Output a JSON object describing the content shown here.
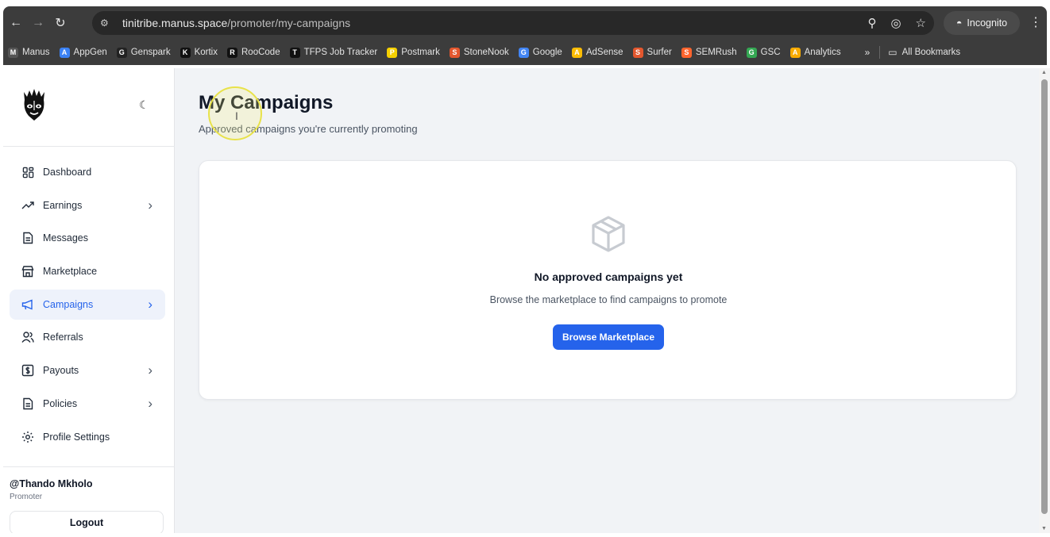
{
  "browser": {
    "url_host": "tinitribe.manus.space",
    "url_path": "/promoter/my-campaigns",
    "incognito_label": "Incognito",
    "bookmarks": [
      {
        "label": "Manus",
        "icon": "M",
        "color": "#555555"
      },
      {
        "label": "AppGen",
        "icon": "A",
        "color": "#3b82f6"
      },
      {
        "label": "Genspark",
        "icon": "G",
        "color": "#222222"
      },
      {
        "label": "Kortix",
        "icon": "K",
        "color": "#111111"
      },
      {
        "label": "RooCode",
        "icon": "R",
        "color": "#111111"
      },
      {
        "label": "TFPS Job Tracker",
        "icon": "T",
        "color": "#111111"
      },
      {
        "label": "Postmark",
        "icon": "P",
        "color": "#f5d000"
      },
      {
        "label": "StoneNook",
        "icon": "S",
        "color": "#e4572e"
      },
      {
        "label": "Google",
        "icon": "G",
        "color": "#4285f4"
      },
      {
        "label": "AdSense",
        "icon": "A",
        "color": "#fbbc04"
      },
      {
        "label": "Surfer",
        "icon": "S",
        "color": "#e4572e"
      },
      {
        "label": "SEMRush",
        "icon": "S",
        "color": "#ff642d"
      },
      {
        "label": "GSC",
        "icon": "G",
        "color": "#34a853"
      },
      {
        "label": "Analytics",
        "icon": "A",
        "color": "#f9ab00"
      }
    ],
    "more_label": "»",
    "all_bookmarks": "All Bookmarks"
  },
  "sidebar": {
    "items": [
      {
        "label": "Dashboard",
        "icon": "grid-icon",
        "has_chevron": false
      },
      {
        "label": "Earnings",
        "icon": "trending-up-icon",
        "has_chevron": true
      },
      {
        "label": "Messages",
        "icon": "file-text-icon",
        "has_chevron": false
      },
      {
        "label": "Marketplace",
        "icon": "store-icon",
        "has_chevron": false
      },
      {
        "label": "Campaigns",
        "icon": "megaphone-icon",
        "has_chevron": true,
        "active": true
      },
      {
        "label": "Referrals",
        "icon": "users-icon",
        "has_chevron": false
      },
      {
        "label": "Payouts",
        "icon": "dollar-square-icon",
        "has_chevron": true
      },
      {
        "label": "Policies",
        "icon": "file-icon",
        "has_chevron": true
      },
      {
        "label": "Profile Settings",
        "icon": "gear-icon",
        "has_chevron": false
      }
    ],
    "user_name": "@Thando Mkholo",
    "user_role": "Promoter",
    "logout_label": "Logout"
  },
  "main": {
    "title": "My Campaigns",
    "subtitle": "Approved campaigns you're currently promoting",
    "empty_title": "No approved campaigns yet",
    "empty_desc": "Browse the marketplace to find campaigns to promote",
    "browse_button": "Browse Marketplace"
  },
  "colors": {
    "accent": "#2563eb",
    "active_bg": "#eef2fb",
    "page_bg": "#f1f3f6"
  }
}
